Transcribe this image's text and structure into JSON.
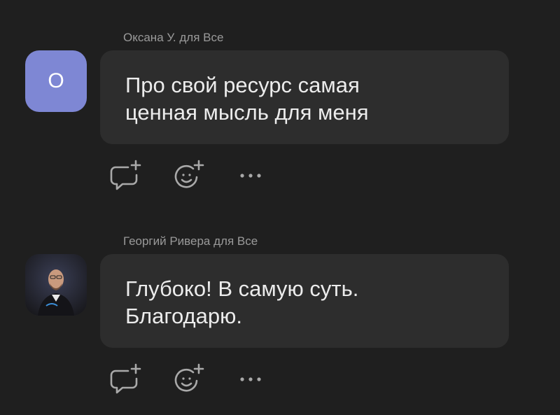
{
  "comments": [
    {
      "sender": "Оксана У. для Все",
      "avatar_letter": "О",
      "text": "Про свой ресурс самая\nценная мысль для меня"
    },
    {
      "sender": "Георгий Ривера для Все",
      "text": "Глубоко! В самую суть.\nБлагодарю."
    }
  ],
  "icons": {
    "reply": "comment-plus-icon",
    "reaction": "emoji-plus-icon",
    "more": "more-dots-icon"
  },
  "colors": {
    "background": "#1f1f1f",
    "bubble": "#2d2d2d",
    "avatar_accent": "#7e87d4",
    "sender_text": "#9a9a9a",
    "message_text": "#ececec",
    "icon": "#a9a9a9"
  }
}
